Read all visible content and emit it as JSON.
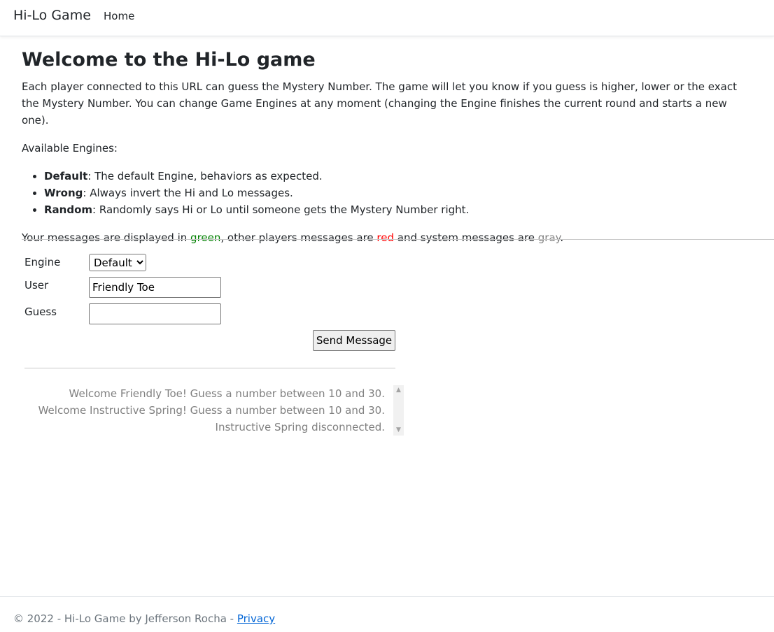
{
  "navbar": {
    "brand": "Hi-Lo Game",
    "home": "Home"
  },
  "main": {
    "title": "Welcome to the Hi-Lo game",
    "intro": "Each player connected to this URL can guess the Mystery Number. The game will let you know if you guess is higher, lower or the exact the Mystery Number. You can change Game Engines at any moment (changing the Engine finishes the current round and starts a new one).",
    "engines_label": "Available Engines:",
    "engines": [
      {
        "name": "Default",
        "desc": ": The default Engine, behaviors as expected."
      },
      {
        "name": "Wrong",
        "desc": ": Always invert the Hi and Lo messages."
      },
      {
        "name": "Random",
        "desc": ": Randomly says Hi or Lo until someone gets the Mystery Number right."
      }
    ],
    "legend": {
      "part1": "Your messages are displayed in ",
      "green": "green",
      "part2": ", other players messages are ",
      "red": "red",
      "part3": " and system messages are ",
      "gray": "gray",
      "part4": "."
    }
  },
  "form": {
    "engine_label": "Engine",
    "engine_value": "Default",
    "user_label": "User",
    "user_value": "Friendly Toe",
    "guess_label": "Guess",
    "guess_value": "",
    "send_label": "Send Message"
  },
  "messages": [
    "Welcome Friendly Toe! Guess a number between 10 and 30.",
    "Welcome Instructive Spring! Guess a number between 10 and 30.",
    "Instructive Spring disconnected."
  ],
  "footer": {
    "text": "© 2022 - Hi-Lo Game by Jefferson Rocha - ",
    "privacy": "Privacy"
  },
  "colors": {
    "own_message": "#008000",
    "other_message": "#ff0000",
    "system_message": "#808080",
    "link": "#0366d6"
  },
  "icons": {
    "scroll_up": "▲",
    "scroll_down": "▼",
    "select_arrow": "chevron-down-icon"
  }
}
